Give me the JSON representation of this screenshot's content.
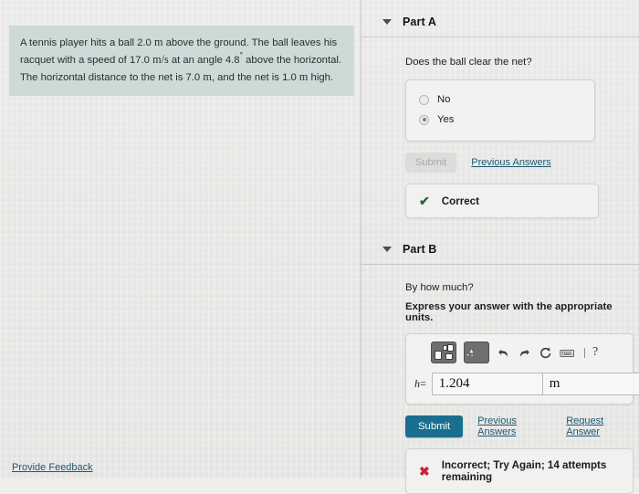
{
  "problem": {
    "line1_a": "A tennis player hits a ball 2.0 ",
    "line1_unit": "m",
    "line1_b": " above the ground. The ball leaves his racquet with",
    "line2_a": "a speed of 17.0 ",
    "line2_unit": "m/s",
    "line2_b": " at an angle 4.8",
    "line2_deg": "°",
    "line2_c": " above the horizontal. The horizontal distance",
    "line3_a": "to the net is 7.0 ",
    "line3_unit": "m",
    "line3_b": ", and the net is 1.0 ",
    "line3_unit2": "m",
    "line3_c": " high."
  },
  "part_a": {
    "title": "Part A",
    "question": "Does the ball clear the net?",
    "options": [
      {
        "label": "No",
        "selected": false
      },
      {
        "label": "Yes",
        "selected": true
      }
    ],
    "submit_label": "Submit",
    "previous_answers_label": "Previous Answers",
    "status_icon": "check-icon",
    "status_text": "Correct"
  },
  "part_b": {
    "title": "Part B",
    "question": "By how much?",
    "instruction": "Express your answer with the appropriate units.",
    "toolbar": [
      {
        "name": "math-template-fraction-button",
        "icon": "template-boxes-icon"
      },
      {
        "name": "math-template-unit-button",
        "icon": "template-unit-icon"
      },
      {
        "name": "undo-button",
        "icon": "undo-arrow-icon"
      },
      {
        "name": "redo-button",
        "icon": "redo-arrow-icon"
      },
      {
        "name": "reset-button",
        "icon": "reset-circle-arrow-icon"
      },
      {
        "name": "keyboard-button",
        "icon": "keyboard-icon"
      },
      {
        "name": "help-button",
        "icon": "question-mark-icon"
      }
    ],
    "variable_label": "h",
    "equals_sign": "=",
    "value": "1.204",
    "value_placeholder": "",
    "units": "m",
    "units_placeholder": "",
    "submit_label": "Submit",
    "previous_answers_label": "Previous Answers",
    "request_answer_label": "Request Answer",
    "status_icon": "x-mark-icon",
    "status_text": "Incorrect; Try Again; 14 attempts remaining"
  },
  "footer": {
    "feedback_label": "Provide Feedback"
  },
  "colors": {
    "problem_background": "#ccdbd8",
    "submit_primary": "#1a6e8e",
    "link": "#1d5a74",
    "correct_green": "#1d6b33",
    "incorrect_red": "#cc2233",
    "page_background": "#eeeeec"
  }
}
